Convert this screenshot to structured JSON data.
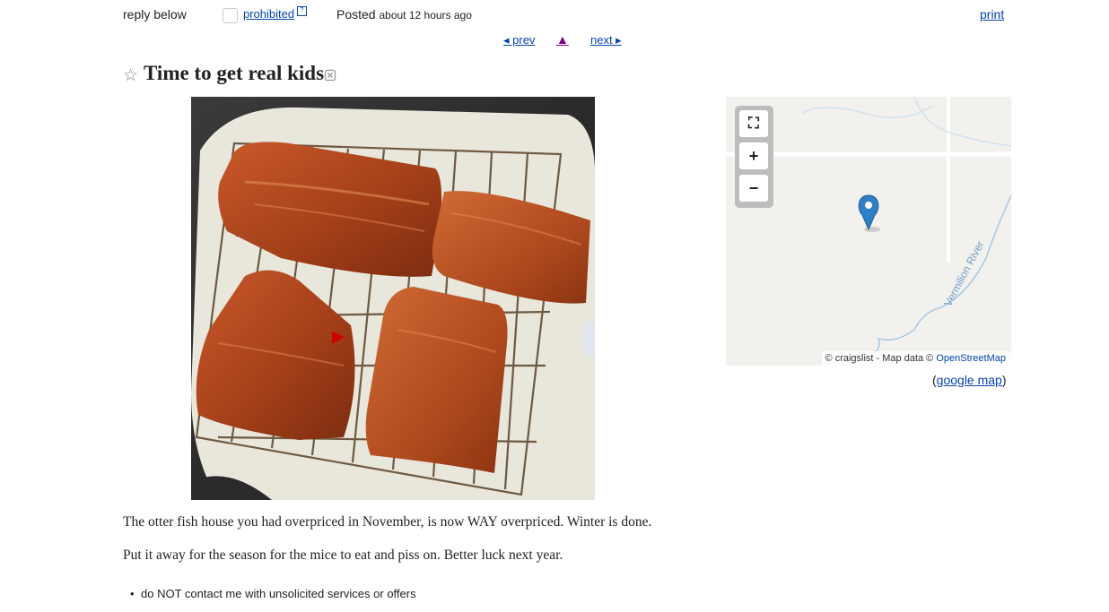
{
  "header": {
    "reply_label": "reply below",
    "prohibited_link": "prohibited",
    "ext_icon_glyph": "?",
    "posted_label": "Posted",
    "posted_time": "about 12 hours ago",
    "print_link": "print"
  },
  "nav": {
    "prev_label": "◂ prev",
    "up_label": "▲",
    "next_label": "next ▸"
  },
  "post": {
    "star_glyph": "☆",
    "title": "Time to get real kids",
    "body_paragraphs": [
      "The otter fish house you had overpriced in November, is now WAY overpriced. Winter is done.",
      "Put it away for the season for the mice to eat and piss on. Better luck next year."
    ],
    "notices": [
      "do NOT contact me with unsolicited services or offers"
    ]
  },
  "image": {
    "icon": "photo-smoked-salmon",
    "accent_colors": {
      "salmon": "#b5461c",
      "tray": "#e8e4d8",
      "background": "#2a2a2a"
    }
  },
  "map": {
    "controls": {
      "fullscreen": "⛶",
      "zoom_in": "+",
      "zoom_out": "−"
    },
    "river_label": "Vermilion River",
    "attribution_prefix": "© craigslist - Map data ©",
    "attribution_link": "OpenStreetMap",
    "google_map_open": "(",
    "google_map_link": "google map",
    "google_map_close": ")",
    "marker_color": "#2f7fc8"
  }
}
